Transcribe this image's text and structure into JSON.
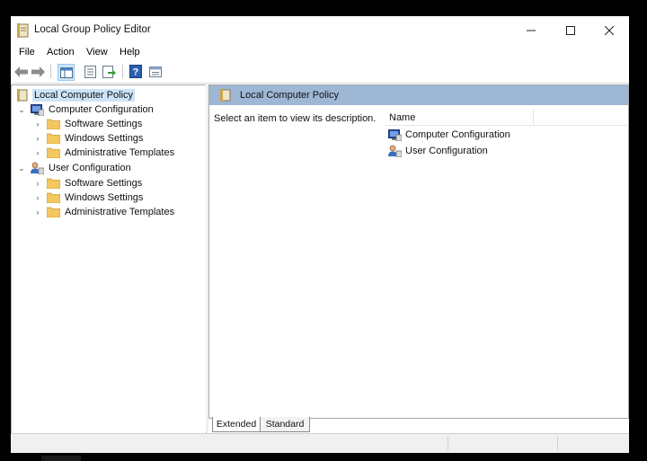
{
  "window": {
    "title": "Local Group Policy Editor"
  },
  "menu": [
    "File",
    "Action",
    "View",
    "Help"
  ],
  "toolbar": {
    "buttons": [
      "back-arrow-icon",
      "forward-arrow-icon",
      "show-hide-console-tree-icon",
      "export-list-icon",
      "open-icon",
      "help-icon",
      "properties-icon"
    ]
  },
  "tree": {
    "root": "Local Computer Policy",
    "computer": {
      "label": "Computer Configuration",
      "children": [
        "Software Settings",
        "Windows Settings",
        "Administrative Templates"
      ]
    },
    "user": {
      "label": "User Configuration",
      "children": [
        "Software Settings",
        "Windows Settings",
        "Administrative Templates"
      ]
    }
  },
  "right_pane": {
    "header": "Local Computer Policy",
    "description": "Select an item to view its description.",
    "column_name": "Name",
    "items": [
      "Computer Configuration",
      "User Configuration"
    ]
  },
  "tabs": [
    "Extended",
    "Standard"
  ],
  "colors": {
    "header_bar": "#9db7d5",
    "selection": "#cce4f7",
    "folder": "#f5c85f"
  }
}
